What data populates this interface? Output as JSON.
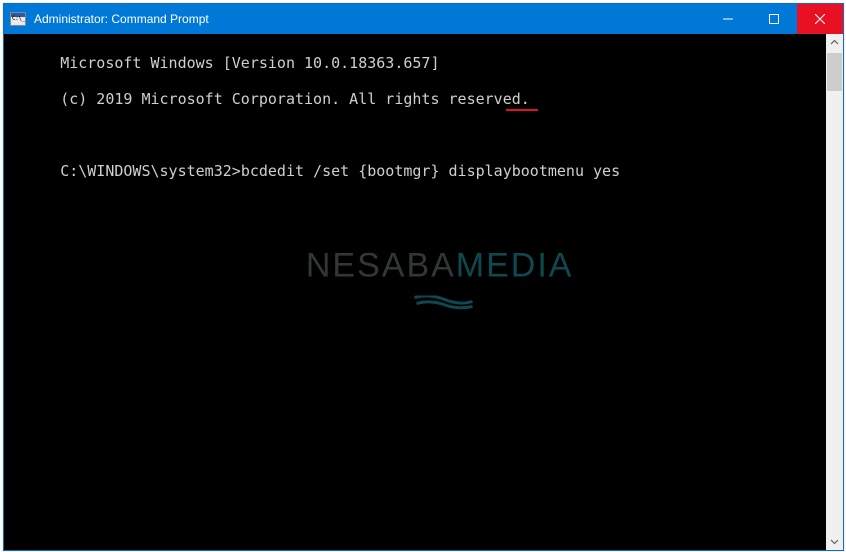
{
  "window": {
    "title": "Administrator: Command Prompt"
  },
  "terminal": {
    "line1": "Microsoft Windows [Version 10.0.18363.657]",
    "line2": "(c) 2019 Microsoft Corporation. All rights reserved.",
    "blank": "",
    "prompt_path": "C:\\WINDOWS\\system32>",
    "command": "bcdedit /set {bootmgr} displaybootmenu yes"
  },
  "watermark": {
    "part1": "NESABA",
    "part2": "MEDIA"
  }
}
